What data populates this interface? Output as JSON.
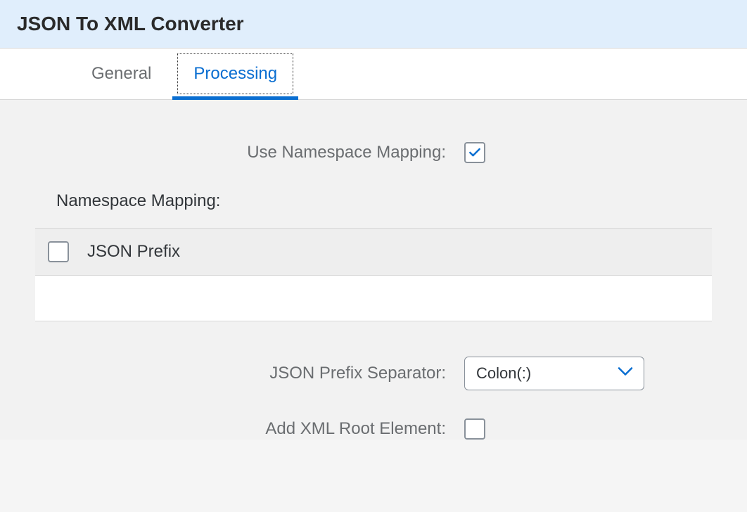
{
  "header": {
    "title": "JSON To XML Converter"
  },
  "tabs": [
    {
      "label": "General",
      "active": false
    },
    {
      "label": "Processing",
      "active": true
    }
  ],
  "form": {
    "useNamespaceMapping": {
      "label": "Use Namespace Mapping:",
      "checked": true
    },
    "namespaceMapping": {
      "sectionLabel": "Namespace Mapping:",
      "columnHeader": "JSON Prefix"
    },
    "jsonPrefixSeparator": {
      "label": "JSON Prefix Separator:",
      "value": "Colon(:)"
    },
    "addXmlRootElement": {
      "label": "Add XML Root Element:",
      "checked": false
    }
  }
}
